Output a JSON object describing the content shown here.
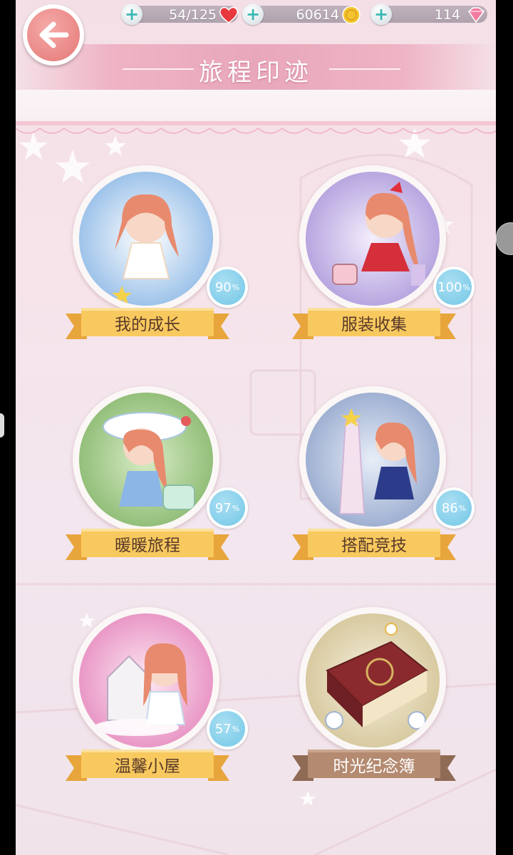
{
  "header": {
    "title": "旅程印迹",
    "back_icon": "back-arrow-icon"
  },
  "resources": {
    "stamina": {
      "value": "54/125",
      "icon": "heart-icon"
    },
    "coins": {
      "value": "60614",
      "icon": "gold-coin-icon"
    },
    "diamonds": {
      "value": "114",
      "icon": "diamond-icon"
    }
  },
  "cards": [
    {
      "label": "我的成长",
      "percent": "90",
      "unit": "%",
      "theme": "#c9dcf3"
    },
    {
      "label": "服装收集",
      "percent": "100",
      "unit": "%",
      "theme": "#d3c9ec"
    },
    {
      "label": "暖暖旅程",
      "percent": "97",
      "unit": "%",
      "theme": "#b8d6a4"
    },
    {
      "label": "搭配竞技",
      "percent": "86",
      "unit": "%",
      "theme": "#c4cfe6"
    },
    {
      "label": "温馨小屋",
      "percent": "57",
      "unit": "%",
      "theme": "#f1c2dc"
    },
    {
      "label": "时光纪念簿",
      "percent": null,
      "unit": null,
      "theme": "#e9e0c2"
    }
  ],
  "colors": {
    "ribbon_gold": "#f6c45c",
    "ribbon_dark": "#e7a53c",
    "ribbon_brown": "#a87e66",
    "percent_badge": "#7cc9e7",
    "back_button": "#e98785"
  }
}
